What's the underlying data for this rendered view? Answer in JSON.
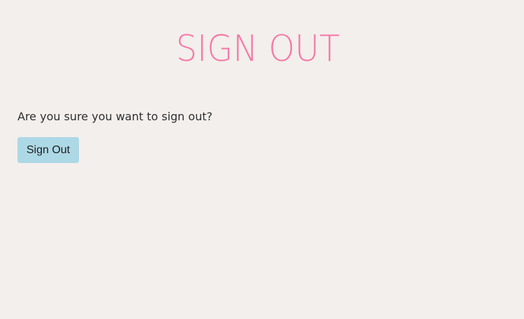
{
  "page": {
    "title": "SIGN OUT",
    "message": "Are you sure you want to sign out?",
    "button_label": "Sign Out"
  },
  "colors": {
    "background": "#f3efec",
    "title": "#f57aa8",
    "text": "#2f2f2f",
    "button_background": "#add8e6"
  }
}
